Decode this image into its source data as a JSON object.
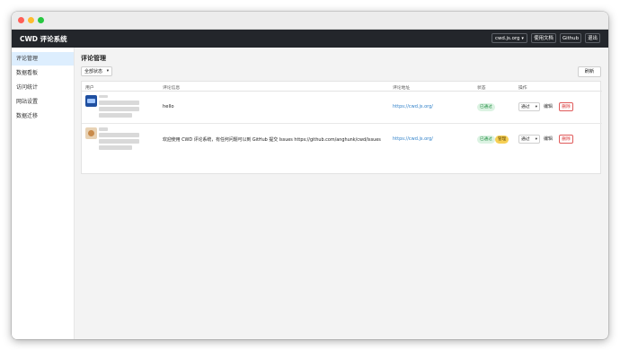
{
  "app": {
    "brand": "CWD 评论系统",
    "nav": {
      "site_select": "cwd.js.org",
      "docs": "使用文档",
      "github": "Github",
      "logout": "退出"
    }
  },
  "sidebar": {
    "items": [
      {
        "label": "评论管理",
        "active": true
      },
      {
        "label": "数据看板"
      },
      {
        "label": "访问统计"
      },
      {
        "label": "网站设置"
      },
      {
        "label": "数据迁移"
      }
    ]
  },
  "main": {
    "title": "评论管理",
    "filter_label": "全部状态",
    "refresh_label": "刷新",
    "columns": [
      "用户",
      "评论信息",
      "评论地址",
      "状态",
      "操作"
    ],
    "rows": [
      {
        "comment": "hello",
        "url": "https://cwd.js.org/",
        "status": "已通过",
        "badge": "",
        "action_select": "通过",
        "edit": "编辑",
        "delete": "删除"
      },
      {
        "comment": "欢迎使用 CWD 评论系统，有任何问题可以到 GitHub 提交 Issues  https://github.com/anghunk/cwd/issues",
        "url": "https://cwd.js.org/",
        "status": "已通过",
        "badge": "管理",
        "action_select": "通过",
        "edit": "编辑",
        "delete": "删除"
      }
    ]
  },
  "colors": {
    "appbar": "#23262b",
    "sidebar_active": "#ddeefe",
    "link": "#2f80c9",
    "status_ok": "#1c8a3c",
    "admin_badge": "#f6cf54",
    "danger": "#d93636"
  }
}
